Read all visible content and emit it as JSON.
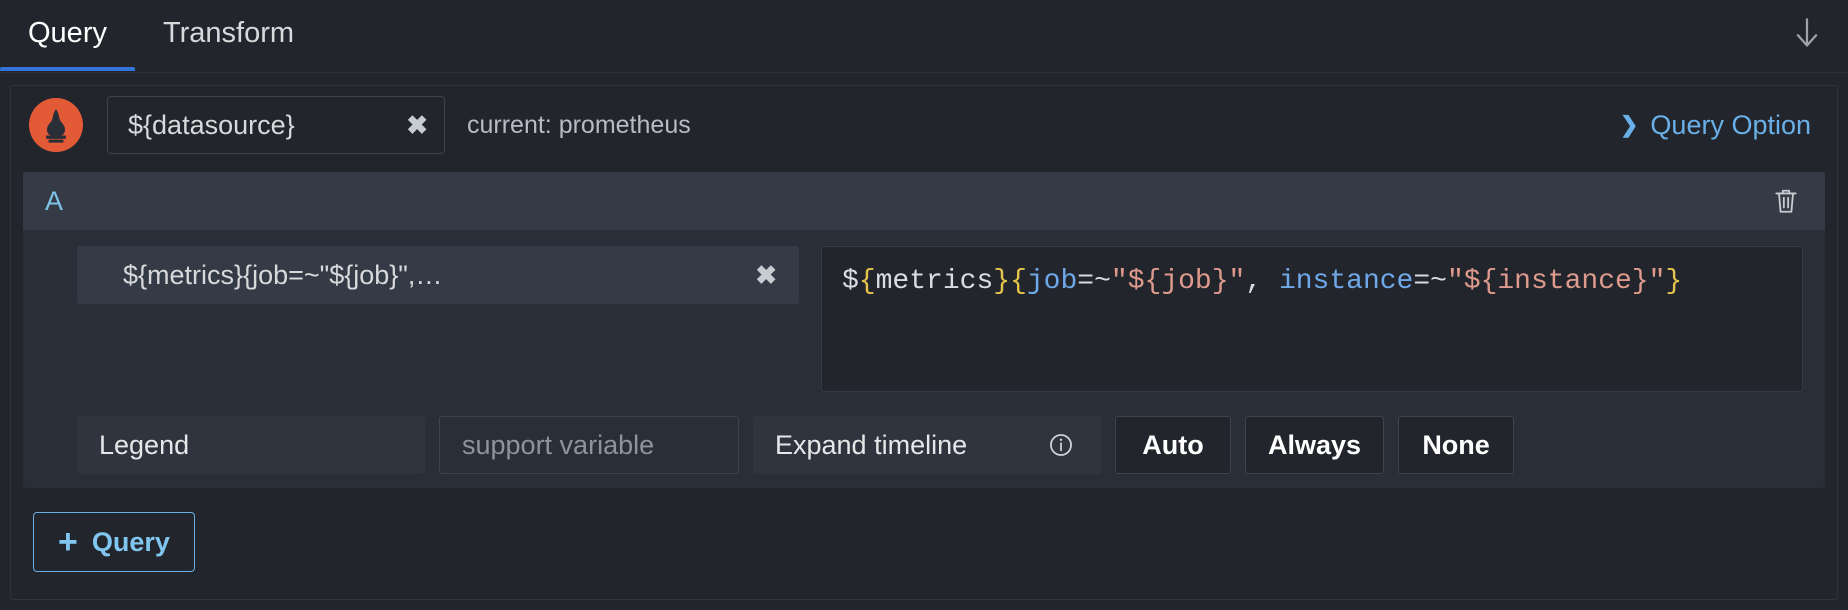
{
  "tabs": [
    {
      "label": "Query",
      "active": true
    },
    {
      "label": "Transform",
      "active": false
    }
  ],
  "header": {
    "download_icon": "download-arrow-icon"
  },
  "datasource": {
    "logo": "prometheus-logo",
    "value": "${datasource}",
    "clear_label": "✖",
    "current_text": "current: prometheus"
  },
  "query_option": {
    "chevron": "❯",
    "label": "Query Option"
  },
  "query": {
    "ref_id": "A",
    "delete_icon": "trash-icon",
    "metric_select": {
      "value": "${metrics}{job=~\"${job}\",…",
      "clear_label": "✖"
    },
    "expression": {
      "full_text": "${metrics}{job=~\"${job}\", instance=~\"${instance}\"}",
      "tokens": [
        {
          "text": "$",
          "type": "var"
        },
        {
          "text": "{",
          "type": "brace"
        },
        {
          "text": "metrics",
          "type": "var"
        },
        {
          "text": "}",
          "type": "brace"
        },
        {
          "text": "{",
          "type": "brace"
        },
        {
          "text": "job",
          "type": "label"
        },
        {
          "text": "=~",
          "type": "op"
        },
        {
          "text": "\"${job}\"",
          "type": "str"
        },
        {
          "text": ", ",
          "type": "punct"
        },
        {
          "text": "instance",
          "type": "label"
        },
        {
          "text": "=~",
          "type": "op"
        },
        {
          "text": "\"${instance}\"",
          "type": "str"
        },
        {
          "text": "}",
          "type": "brace"
        }
      ]
    },
    "legend": {
      "label": "Legend",
      "placeholder": "support variable",
      "value": ""
    },
    "expand_timeline": {
      "label": "Expand timeline",
      "info_icon": "info-circle-icon",
      "options": [
        "Auto",
        "Always",
        "None"
      ]
    }
  },
  "add_query": {
    "plus": "+",
    "label": "Query"
  },
  "colors": {
    "panel_bg": "#22252b",
    "card_bg": "#2a2e38",
    "head_bg": "#343a46",
    "accent_blue": "#3274d9",
    "link_blue": "#6ab0e8",
    "prometheus_orange": "#e35a36",
    "token_brace": "#e3c44a",
    "token_label": "#6fa8e8",
    "token_string": "#dd9a8d"
  }
}
